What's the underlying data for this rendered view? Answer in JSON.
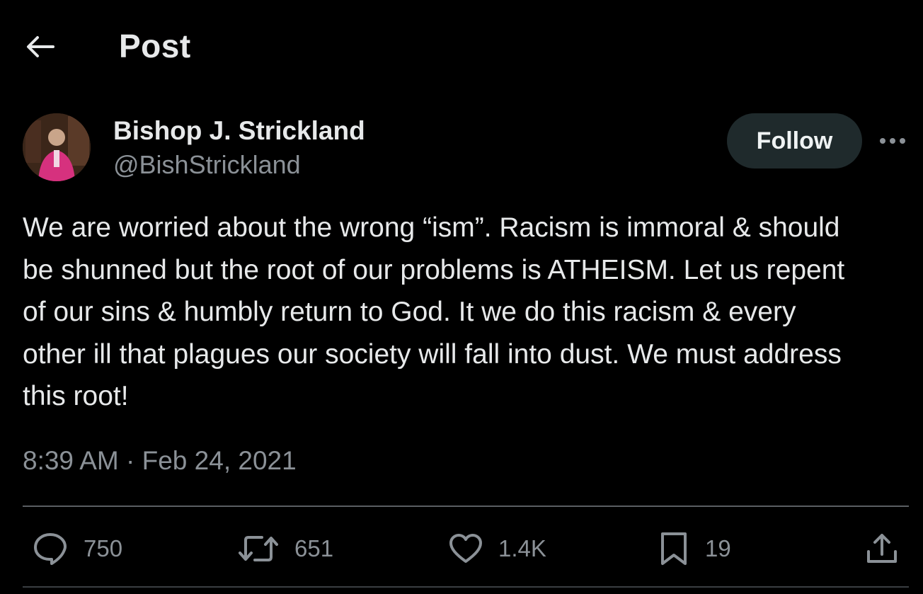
{
  "header": {
    "title": "Post"
  },
  "author": {
    "display_name": "Bishop J. Strickland",
    "handle": "@BishStrickland",
    "follow_label": "Follow"
  },
  "post": {
    "text": "We are worried about the wrong “ism”. Racism is immoral & should\nbe shunned but the root of our problems is ATHEISM. Let us repent\nof our sins & humbly return to God. It we do this racism & every\nother ill that plagues our society will fall into dust. We must address\nthis root!",
    "timestamp": "8:39 AM · Feb 24, 2021"
  },
  "actions": {
    "replies": "750",
    "reposts": "651",
    "likes": "1.4K",
    "bookmarks": "19"
  },
  "icons": {
    "back": "arrow-left-icon",
    "more": "more-horizontal-icon",
    "reply": "speech-bubble-icon",
    "repost": "repost-icon",
    "like": "heart-icon",
    "bookmark": "bookmark-icon",
    "share": "share-icon"
  },
  "colors": {
    "background": "#000000",
    "primary_text": "#e7e9ea",
    "secondary_text": "#8b9197",
    "follow_bg": "#1f2a2c"
  }
}
